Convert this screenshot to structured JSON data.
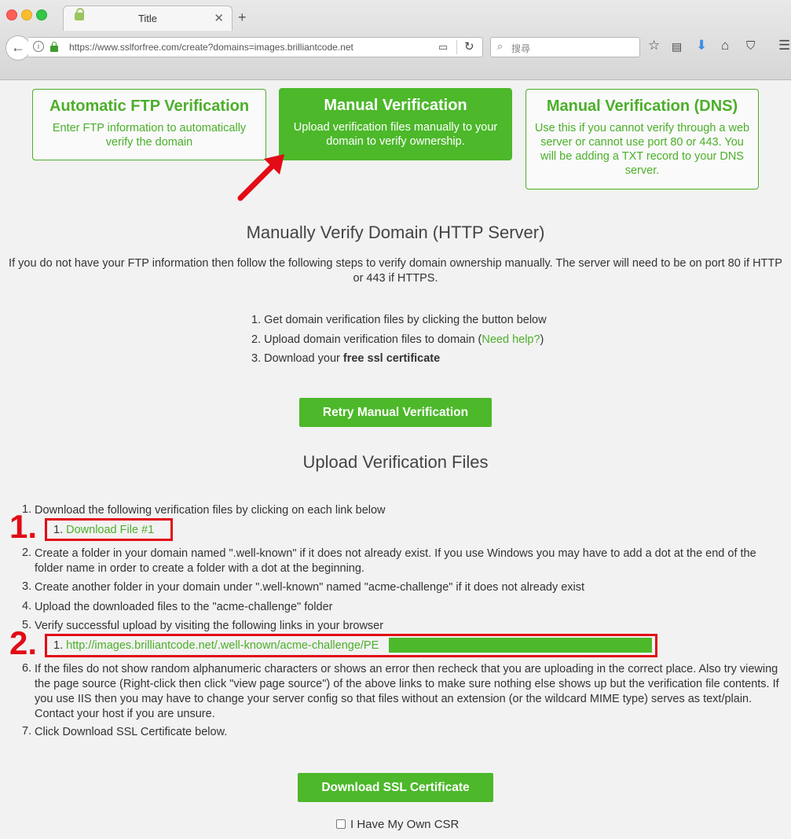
{
  "browser": {
    "tab_title": "Title",
    "new_tab": "+",
    "url": "https://www.sslforfree.com/create?domains=images.brilliantcode.net",
    "search_placeholder": "搜尋"
  },
  "cards": [
    {
      "title": "Automatic FTP Verification",
      "desc": "Enter FTP information to automatically verify the domain"
    },
    {
      "title": "Manual Verification",
      "desc": "Upload verification files manually to your domain to verify ownership."
    },
    {
      "title": "Manual Verification (DNS)",
      "desc": "Use this if you cannot verify through a web server or cannot use port 80 or 443. You will be adding a TXT record to your DNS server."
    }
  ],
  "manual": {
    "heading": "Manually Verify Domain (HTTP Server)",
    "intro": "If you do not have your FTP information then follow the following steps to verify domain ownership manually. The server will need to be on port 80 if HTTP or 443 if HTTPS.",
    "step1": "1. Get domain verification files by clicking the button below",
    "step2_pre": "2. Upload domain verification files to domain (",
    "step2_link": "Need help?",
    "step2_post": ")",
    "step3_pre": "3. Download your ",
    "step3_bold": "free ssl certificate",
    "retry_button": "Retry Manual Verification"
  },
  "upload": {
    "heading": "Upload Verification Files",
    "item1": "Download the following verification files by clicking on each link below",
    "download_file": "Download File #1",
    "item2": "Create a folder in your domain named \".well-known\" if it does not already exist. If you use Windows you may have to add a dot at the end of the folder name in order to create a folder with a dot at the beginning.",
    "item3": "Create another folder in your domain under \".well-known\" named \"acme-challenge\" if it does not already exist",
    "item4": "Upload the downloaded files to the \"acme-challenge\" folder",
    "item5": "Verify successful upload by visiting the following links in your browser",
    "verify_link": "http://images.brilliantcode.net/.well-known/acme-challenge/PE",
    "item6": "If the files do not show random alphanumeric characters or shows an error then recheck that you are uploading in the correct place. Also try viewing the page source (Right-click then click \"view page source\") of the above links to make sure nothing else shows up but the verification file contents. If you use IIS then you may have to change your server config so that files without an extension (or the wildcard MIME type) serves as text/plain. Contact your host if you are unsure.",
    "item7": "Click Download SSL Certificate below.",
    "download_ssl_button": "Download SSL Certificate",
    "csr_label": "I Have My Own CSR"
  },
  "annotations": {
    "mark1": "1.",
    "mark2": "2.",
    "color": "#e20b16"
  },
  "accent_color": "#4cb82a"
}
